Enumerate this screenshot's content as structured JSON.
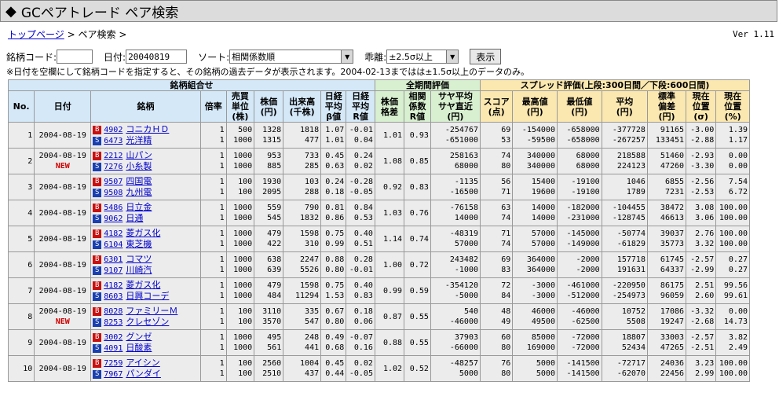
{
  "title": "GCペアトレード ペア検索",
  "breadcrumb": {
    "home": "トップページ",
    "sep1": ">",
    "current": "ペア検索",
    "sep2": ">"
  },
  "version": "Ver 1.11",
  "form": {
    "code_label": "銘柄コード:",
    "code_value": "",
    "date_label": "日付:",
    "date_value": "20040819",
    "sort_label": "ソート:",
    "sort_value": "相関係数順",
    "dev_label": "乖離:",
    "dev_value": "±2.5σ以上",
    "submit": "表示"
  },
  "note": "※日付を空欄にして銘柄コードを指定すると、その銘柄の過去データが表示されます。2004-02-13まではは±1.5σ以上のデータのみ。",
  "table": {
    "group_headers": {
      "pair": "銘柄組合せ",
      "all": "全期間評価",
      "spread": "スプレッド評価(上段:300日間／下段:600日間)"
    },
    "headers": {
      "no": "No.",
      "date": "日付",
      "stock": "銘柄",
      "ratio": "倍率",
      "unit": [
        "売買",
        "単位",
        "(株)"
      ],
      "price": [
        "株価",
        "(円)"
      ],
      "volume": [
        "出来高",
        "(千株)"
      ],
      "beta": [
        "日経",
        "平均",
        "β値"
      ],
      "r": [
        "日経",
        "平均",
        "R値"
      ],
      "spread_pct": [
        "株価",
        "格差"
      ],
      "corr": [
        "相関",
        "係数",
        "R値"
      ],
      "saya": [
        "サヤ平均",
        "サヤ直近",
        "(円)"
      ],
      "score": [
        "スコア",
        "(点)"
      ],
      "high": [
        "最高値",
        "(円)"
      ],
      "low": [
        "最低値",
        "(円)"
      ],
      "avg": [
        "平均",
        "(円)"
      ],
      "std": [
        "標準",
        "偏差",
        "(円)"
      ],
      "pos_sigma": [
        "現在",
        "位置",
        "(σ)"
      ],
      "pos_pct": [
        "現在",
        "位置",
        "(%)"
      ]
    },
    "rows": [
      {
        "no": "1",
        "date": "2004-08-19",
        "new": "",
        "r": [
          "1",
          "1"
        ],
        "u": [
          "500",
          "1000"
        ],
        "p": [
          "1328",
          "1315"
        ],
        "v": [
          "1818",
          "477"
        ],
        "beta": [
          "1.07",
          "1.01"
        ],
        "rv": [
          "-0.01",
          "0.04"
        ],
        "sp": "1.01",
        "corr": "0.93",
        "saya": [
          "-254767",
          "-651000"
        ],
        "score": [
          "69",
          "53"
        ],
        "hi": [
          "-154000",
          "-59500"
        ],
        "lo": [
          "-658000",
          "-658000"
        ],
        "avg": [
          "-377728",
          "-267257"
        ],
        "std": [
          "91165",
          "133451"
        ],
        "ps": [
          "-3.00",
          "-2.88"
        ],
        "pp": [
          "1.39",
          "1.17"
        ],
        "b": {
          "code": "4902",
          "name": "コニカＨＤ"
        },
        "s": {
          "code": "6473",
          "name": "光洋精"
        }
      },
      {
        "no": "2",
        "date": "2004-08-19",
        "new": "NEW",
        "r": [
          "1",
          "1"
        ],
        "u": [
          "1000",
          "1000"
        ],
        "p": [
          "953",
          "885"
        ],
        "v": [
          "733",
          "285"
        ],
        "beta": [
          "0.45",
          "0.63"
        ],
        "rv": [
          "0.24",
          "0.02"
        ],
        "sp": "1.08",
        "corr": "0.85",
        "saya": [
          "258163",
          "68000"
        ],
        "score": [
          "74",
          "80"
        ],
        "hi": [
          "340000",
          "340000"
        ],
        "lo": [
          "68000",
          "68000"
        ],
        "avg": [
          "218588",
          "224123"
        ],
        "std": [
          "51460",
          "47260"
        ],
        "ps": [
          "-2.93",
          "-3.30"
        ],
        "pp": [
          "0.00",
          "0.00"
        ],
        "b": {
          "code": "2212",
          "name": "山パン"
        },
        "s": {
          "code": "7276",
          "name": "小糸製"
        }
      },
      {
        "no": "3",
        "date": "2004-08-19",
        "new": "",
        "r": [
          "1",
          "1"
        ],
        "u": [
          "100",
          "100"
        ],
        "p": [
          "1930",
          "2095"
        ],
        "v": [
          "103",
          "288"
        ],
        "beta": [
          "0.24",
          "0.18"
        ],
        "rv": [
          "-0.28",
          "-0.05"
        ],
        "sp": "0.92",
        "corr": "0.83",
        "saya": [
          "-1135",
          "-16500"
        ],
        "score": [
          "56",
          "71"
        ],
        "hi": [
          "15400",
          "19600"
        ],
        "lo": [
          "-19100",
          "-19100"
        ],
        "avg": [
          "1046",
          "1789"
        ],
        "std": [
          "6855",
          "7231"
        ],
        "ps": [
          "-2.56",
          "-2.53"
        ],
        "pp": [
          "7.54",
          "6.72"
        ],
        "b": {
          "code": "9507",
          "name": "四国電"
        },
        "s": {
          "code": "9508",
          "name": "九州電"
        }
      },
      {
        "no": "4",
        "date": "2004-08-19",
        "new": "",
        "r": [
          "1",
          "1"
        ],
        "u": [
          "1000",
          "1000"
        ],
        "p": [
          "559",
          "545"
        ],
        "v": [
          "790",
          "1832"
        ],
        "beta": [
          "0.81",
          "0.86"
        ],
        "rv": [
          "0.84",
          "0.53"
        ],
        "sp": "1.03",
        "corr": "0.76",
        "saya": [
          "-76158",
          "14000"
        ],
        "score": [
          "63",
          "74"
        ],
        "hi": [
          "14000",
          "14000"
        ],
        "lo": [
          "-182000",
          "-231000"
        ],
        "avg": [
          "-104455",
          "-128745"
        ],
        "std": [
          "38472",
          "46613"
        ],
        "ps": [
          "3.08",
          "3.06"
        ],
        "pp": [
          "100.00",
          "100.00"
        ],
        "b": {
          "code": "5486",
          "name": "日立金"
        },
        "s": {
          "code": "9062",
          "name": "日通"
        }
      },
      {
        "no": "5",
        "date": "2004-08-19",
        "new": "",
        "r": [
          "1",
          "1"
        ],
        "u": [
          "1000",
          "1000"
        ],
        "p": [
          "479",
          "422"
        ],
        "v": [
          "1598",
          "310"
        ],
        "beta": [
          "0.75",
          "0.99"
        ],
        "rv": [
          "0.40",
          "0.51"
        ],
        "sp": "1.14",
        "corr": "0.74",
        "saya": [
          "-48319",
          "57000"
        ],
        "score": [
          "71",
          "74"
        ],
        "hi": [
          "57000",
          "57000"
        ],
        "lo": [
          "-145000",
          "-149000"
        ],
        "avg": [
          "-50774",
          "-61829"
        ],
        "std": [
          "39037",
          "35773"
        ],
        "ps": [
          "2.76",
          "3.32"
        ],
        "pp": [
          "100.00",
          "100.00"
        ],
        "b": {
          "code": "4182",
          "name": "菱ガス化"
        },
        "s": {
          "code": "6104",
          "name": "東芝機"
        }
      },
      {
        "no": "6",
        "date": "2004-08-19",
        "new": "",
        "r": [
          "1",
          "1"
        ],
        "u": [
          "1000",
          "1000"
        ],
        "p": [
          "638",
          "639"
        ],
        "v": [
          "2247",
          "5526"
        ],
        "beta": [
          "0.88",
          "0.80"
        ],
        "rv": [
          "0.28",
          "-0.01"
        ],
        "sp": "1.00",
        "corr": "0.72",
        "saya": [
          "243482",
          "-1000"
        ],
        "score": [
          "69",
          "83"
        ],
        "hi": [
          "364000",
          "364000"
        ],
        "lo": [
          "-2000",
          "-2000"
        ],
        "avg": [
          "157718",
          "191631"
        ],
        "std": [
          "61745",
          "64337"
        ],
        "ps": [
          "-2.57",
          "-2.99"
        ],
        "pp": [
          "0.27",
          "0.27"
        ],
        "b": {
          "code": "6301",
          "name": "コマツ"
        },
        "s": {
          "code": "9107",
          "name": "川崎汽"
        }
      },
      {
        "no": "7",
        "date": "2004-08-19",
        "new": "",
        "r": [
          "1",
          "1"
        ],
        "u": [
          "1000",
          "1000"
        ],
        "p": [
          "479",
          "484"
        ],
        "v": [
          "1598",
          "11294"
        ],
        "beta": [
          "0.75",
          "1.53"
        ],
        "rv": [
          "0.40",
          "0.83"
        ],
        "sp": "0.99",
        "corr": "0.59",
        "saya": [
          "-354120",
          "-5000"
        ],
        "score": [
          "72",
          "84"
        ],
        "hi": [
          "-3000",
          "-3000"
        ],
        "lo": [
          "-461000",
          "-512000"
        ],
        "avg": [
          "-220950",
          "-254973"
        ],
        "std": [
          "86175",
          "96059"
        ],
        "ps": [
          "2.51",
          "2.60"
        ],
        "pp": [
          "99.56",
          "99.61"
        ],
        "b": {
          "code": "4182",
          "name": "菱ガス化"
        },
        "s": {
          "code": "8603",
          "name": "日興コーデ"
        }
      },
      {
        "no": "8",
        "date": "2004-08-19",
        "new": "NEW",
        "r": [
          "1",
          "1"
        ],
        "u": [
          "100",
          "100"
        ],
        "p": [
          "3110",
          "3570"
        ],
        "v": [
          "335",
          "547"
        ],
        "beta": [
          "0.67",
          "0.80"
        ],
        "rv": [
          "0.18",
          "0.06"
        ],
        "sp": "0.87",
        "corr": "0.55",
        "saya": [
          "540",
          "-46000"
        ],
        "score": [
          "48",
          "49"
        ],
        "hi": [
          "46000",
          "49500"
        ],
        "lo": [
          "-46000",
          "-62500"
        ],
        "avg": [
          "10752",
          "5508"
        ],
        "std": [
          "17086",
          "19247"
        ],
        "ps": [
          "-3.32",
          "-2.68"
        ],
        "pp": [
          "0.00",
          "14.73"
        ],
        "b": {
          "code": "8028",
          "name": "ファミリーＭ"
        },
        "s": {
          "code": "8253",
          "name": "クレセゾン"
        }
      },
      {
        "no": "9",
        "date": "2004-08-19",
        "new": "",
        "r": [
          "1",
          "1"
        ],
        "u": [
          "1000",
          "1000"
        ],
        "p": [
          "495",
          "561"
        ],
        "v": [
          "248",
          "441"
        ],
        "beta": [
          "0.49",
          "0.68"
        ],
        "rv": [
          "-0.07",
          "0.16"
        ],
        "sp": "0.88",
        "corr": "0.55",
        "saya": [
          "37903",
          "-66000"
        ],
        "score": [
          "60",
          "80"
        ],
        "hi": [
          "85000",
          "169000"
        ],
        "lo": [
          "-72000",
          "-72000"
        ],
        "avg": [
          "18807",
          "52434"
        ],
        "std": [
          "33003",
          "47265"
        ],
        "ps": [
          "-2.57",
          "-2.51"
        ],
        "pp": [
          "3.82",
          "2.49"
        ],
        "b": {
          "code": "3002",
          "name": "グンゼ"
        },
        "s": {
          "code": "4091",
          "name": "日酸素"
        }
      },
      {
        "no": "10",
        "date": "2004-08-19",
        "new": "",
        "r": [
          "1",
          "1"
        ],
        "u": [
          "100",
          "100"
        ],
        "p": [
          "2560",
          "2510"
        ],
        "v": [
          "1004",
          "437"
        ],
        "beta": [
          "0.45",
          "0.44"
        ],
        "rv": [
          "0.02",
          "-0.05"
        ],
        "sp": "1.02",
        "corr": "0.52",
        "saya": [
          "-48257",
          "5000"
        ],
        "score": [
          "76",
          "80"
        ],
        "hi": [
          "5000",
          "5000"
        ],
        "lo": [
          "-141500",
          "-141500"
        ],
        "avg": [
          "-72717",
          "-62070"
        ],
        "std": [
          "24036",
          "22456"
        ],
        "ps": [
          "3.23",
          "2.99"
        ],
        "pp": [
          "100.00",
          "100.00"
        ],
        "b": {
          "code": "7259",
          "name": "アイシン"
        },
        "s": {
          "code": "7967",
          "name": "パンダイ"
        }
      }
    ]
  }
}
